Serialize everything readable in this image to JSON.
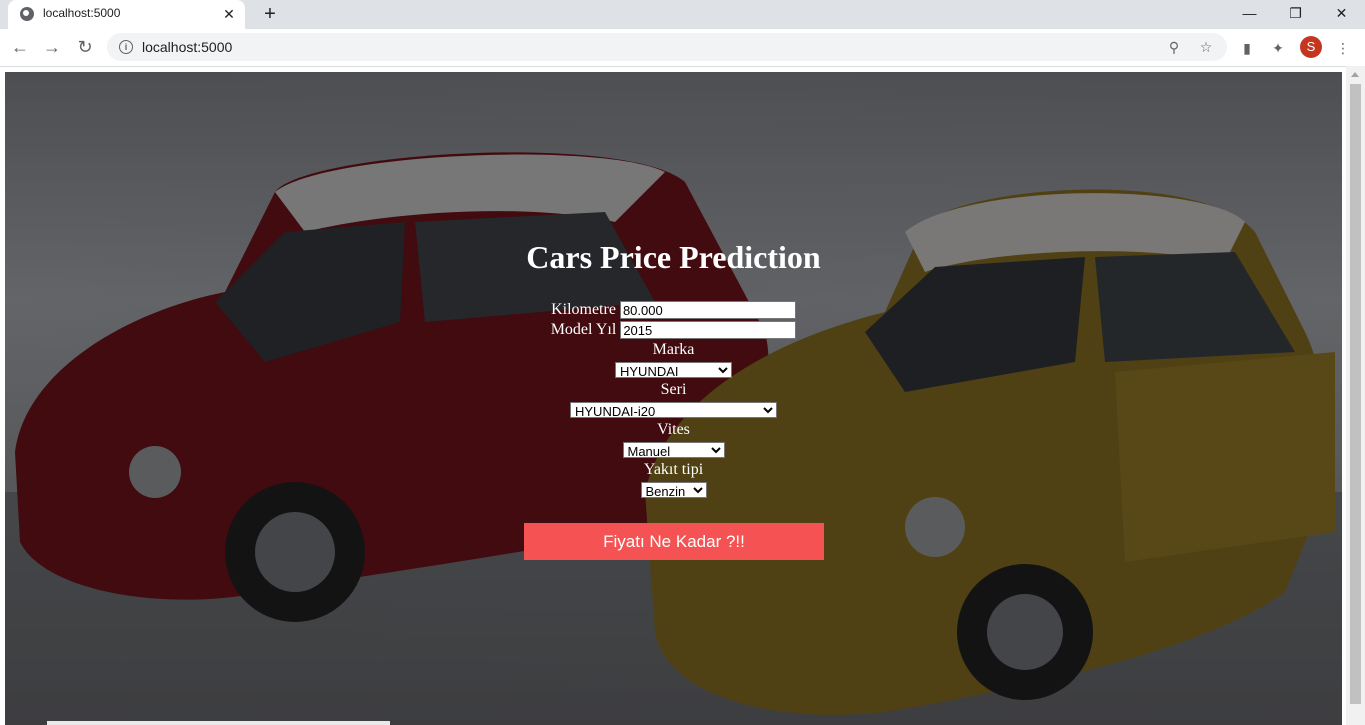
{
  "browser": {
    "tab_title": "localhost:5000",
    "tab_close": "✕",
    "new_tab": "+",
    "url": "localhost:5000",
    "profile_initial": "S"
  },
  "page": {
    "title": "Cars Price Prediction",
    "fields": {
      "kilometre_label": "Kilometre",
      "kilometre_value": "80.000",
      "model_year_label": "Model Yıl",
      "model_year_value": "2015",
      "brand_label": "Marka",
      "brand_value": "HYUNDAI",
      "series_label": "Seri",
      "series_value": "HYUNDAI-i20",
      "gearbox_label": "Vites",
      "gearbox_value": "Manuel",
      "fuel_label": "Yakıt tipi",
      "fuel_value": "Benzin"
    },
    "submit_label": "Fiyatı Ne Kadar ?!!"
  },
  "icons": [
    "globe-icon",
    "close-icon",
    "plus-icon",
    "minimize-icon",
    "restore-icon",
    "window-close-icon",
    "back-arrow-icon",
    "forward-arrow-icon",
    "reload-icon",
    "info-icon",
    "zoom-icon",
    "star-icon",
    "analytics-icon",
    "extensions-icon",
    "profile-avatar",
    "menu-dots-icon"
  ]
}
